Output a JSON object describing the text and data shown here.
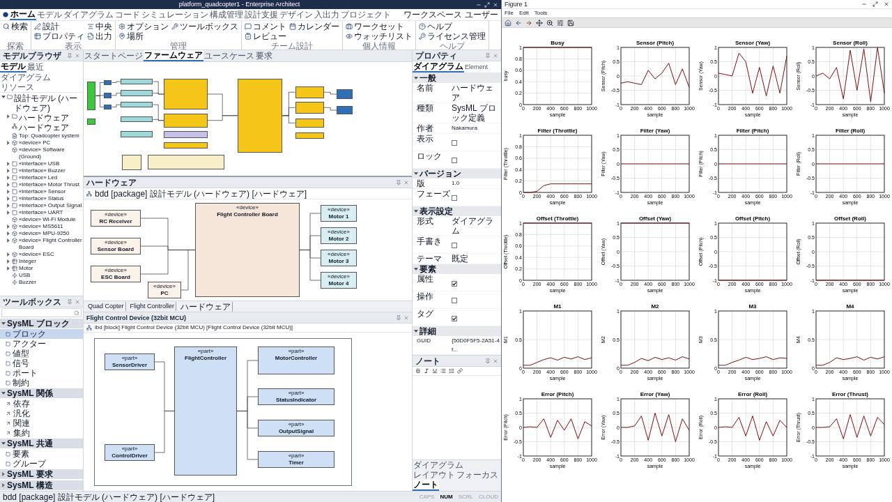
{
  "editor": {
    "title": "platform_quadcopter1 - Enterprise Architect",
    "ribbon_tabs": [
      {
        "label": "ホーム",
        "selected": true
      },
      {
        "label": "モデル",
        "selected": false
      },
      {
        "label": "ダイアグラム",
        "selected": false
      },
      {
        "label": "コード",
        "selected": false
      },
      {
        "label": "シミュレーション",
        "selected": false
      },
      {
        "label": "構成管理",
        "selected": false
      },
      {
        "label": "設計支援",
        "selected": false
      },
      {
        "label": "デザイン",
        "selected": false
      },
      {
        "label": "入出力",
        "selected": false
      },
      {
        "label": "プロジェクト",
        "selected": false
      }
    ],
    "workspace": "ワークスペース",
    "user": "ユーザー",
    "ribbon_groups": [
      {
        "label": "探索",
        "buttons": [
          "検索"
        ]
      },
      {
        "label": "表示",
        "buttons": [
          "設計",
          "プロパティ",
          "中央",
          "出力"
        ]
      },
      {
        "label": "管理",
        "buttons": [
          "オプション",
          "場所",
          "ツールボックス"
        ]
      },
      {
        "label": "チーム設計",
        "buttons": [
          "コメント",
          "レビュー",
          "カレンダー"
        ]
      },
      {
        "label": "個人情報",
        "buttons": [
          "ワークセット",
          "ウォッチリスト"
        ]
      },
      {
        "label": "ヘルプ",
        "buttons": [
          "ヘルプ",
          "ライセンス管理"
        ]
      }
    ],
    "model_browser": {
      "title": "モデルブラウザ",
      "tabs": [
        {
          "label": "モデル",
          "selected": true
        },
        {
          "label": "最近",
          "selected": false
        },
        {
          "label": "ダイアグラム",
          "selected": false
        },
        {
          "label": "リソース",
          "selected": false
        }
      ],
      "tree": [
        {
          "label": "設計モデル (ハードウェア)",
          "kind": "package",
          "expanded": true,
          "children": [
            {
              "label": "ハードウェア",
              "kind": "package",
              "expanded": false
            },
            {
              "label": "ハードウェア",
              "kind": "diagram"
            },
            {
              "label": "Top: Quadcopter system",
              "kind": "note"
            },
            {
              "label": "«device» PC",
              "kind": "device",
              "expanded": false
            },
            {
              "label": "«device» Software (Ground)",
              "kind": "device"
            },
            {
              "label": "«interface» USB",
              "kind": "interface",
              "expanded": false
            },
            {
              "label": "«interface» Buzzer",
              "kind": "interface",
              "expanded": false
            },
            {
              "label": "«interface» Led",
              "kind": "interface",
              "expanded": false
            },
            {
              "label": "«interface» Motor Thrust",
              "kind": "interface",
              "expanded": false
            },
            {
              "label": "«interface» Sensor",
              "kind": "interface",
              "expanded": false
            },
            {
              "label": "«interface» Status",
              "kind": "interface",
              "expanded": false
            },
            {
              "label": "«interface» Output Signal",
              "kind": "interface",
              "expanded": false
            },
            {
              "label": "«interface» UART",
              "kind": "interface",
              "expanded": false
            },
            {
              "label": "«device» Wi-Fi Module",
              "kind": "device"
            },
            {
              "label": "«device» MS5611",
              "kind": "device",
              "expanded": false
            },
            {
              "label": "«device» MPU-9250",
              "kind": "device",
              "expanded": false
            },
            {
              "label": "«device» Flight Controller Board",
              "kind": "device",
              "expanded": false
            },
            {
              "label": "«device» ESC",
              "kind": "device",
              "expanded": false
            },
            {
              "label": "Integer",
              "kind": "class",
              "expanded": false
            },
            {
              "label": "Motor",
              "kind": "class",
              "expanded": false
            },
            {
              "label": "USB",
              "kind": "signal"
            },
            {
              "label": "Buzzer",
              "kind": "signal"
            }
          ]
        }
      ]
    },
    "toolbox": {
      "title": "ツールボックス",
      "groups": [
        {
          "label": "SysML ブロック",
          "expanded": true,
          "items": [
            {
              "label": "ブロック",
              "selected": true
            },
            {
              "label": "アクター",
              "selected": false
            },
            {
              "label": "値型",
              "selected": false
            },
            {
              "label": "信号",
              "selected": false
            },
            {
              "label": "ポート",
              "selected": false
            },
            {
              "label": "制約",
              "selected": false
            }
          ]
        },
        {
          "label": "SysML 関係",
          "expanded": true,
          "items": [
            {
              "label": "依存",
              "selected": false
            },
            {
              "label": "汎化",
              "selected": false
            },
            {
              "label": "関連",
              "selected": false
            },
            {
              "label": "集約",
              "selected": false
            }
          ]
        },
        {
          "label": "SysML 共通",
          "expanded": true,
          "items": [
            {
              "label": "要素",
              "selected": false
            },
            {
              "label": "グループ",
              "selected": false
            }
          ]
        },
        {
          "label": "SysML 要求",
          "expanded": false
        },
        {
          "label": "SysML 構造",
          "expanded": false
        }
      ]
    },
    "diagram_tabs": [
      {
        "label": "スタートページ",
        "selected": false
      },
      {
        "label": "ファームウェア",
        "selected": true
      },
      {
        "label": "ユースケース",
        "selected": false
      },
      {
        "label": "要求",
        "selected": false
      }
    ],
    "firmware_diagram": {
      "nodes": [
        {
          "color": "#3cc83c"
        },
        {
          "color": "#3cc83c"
        },
        {
          "color": "#2e6fb5"
        },
        {
          "color": "#2e6fb5"
        },
        {
          "color": "#2e6fb5"
        },
        {
          "color": "#9ed8d8"
        },
        {
          "color": "#9ed8d8"
        },
        {
          "color": "#9ed8d8"
        },
        {
          "color": "#9ed8d8"
        },
        {
          "color": "#9ed8d8"
        },
        {
          "color": "#f5c518"
        },
        {
          "color": "#f5c518"
        },
        {
          "color": "#c9c0e8"
        },
        {
          "color": "#f5c518"
        },
        {
          "color": "#f5c518"
        },
        {
          "color": "#f5c518"
        },
        {
          "color": "#f5c518"
        },
        {
          "color": "#f5c518"
        },
        {
          "color": "#f5c518"
        },
        {
          "color": "#2e6fb5"
        },
        {
          "color": "#2e6fb5"
        },
        {
          "color": "#f6efc8"
        },
        {
          "color": "#f6efc8"
        }
      ]
    },
    "hardware_pane": {
      "title": "ハードウェア",
      "subtitle": "bdd [package] 設計モデル (ハードウェア) [ハードウェア]",
      "nodes": [
        {
          "stereotype": "«device»",
          "name": "RC Receiver",
          "color": "#fbf3ea"
        },
        {
          "stereotype": "«device»",
          "name": "Sensor Board",
          "color": "#fbf3ea"
        },
        {
          "stereotype": "«device»",
          "name": "ESC Board",
          "color": "#fbf3ea"
        },
        {
          "stereotype": "«device»",
          "name": "PC",
          "color": "#fbf3ea"
        },
        {
          "stereotype": "«device»",
          "name": "Flight Controller Board",
          "color": "#f6e6da"
        },
        {
          "stereotype": "«device»",
          "name": "Motor 1",
          "color": "#d8eef2"
        },
        {
          "stereotype": "«device»",
          "name": "Motor 2",
          "color": "#d8eef2"
        },
        {
          "stereotype": "«device»",
          "name": "Motor 3",
          "color": "#d8eef2"
        },
        {
          "stereotype": "«device»",
          "name": "Motor 4",
          "color": "#d8eef2"
        }
      ],
      "breadcrumb": [
        "Quad Copter",
        "Flight Controller",
        "ハードウェア"
      ]
    },
    "device_pane": {
      "title": "Flight Control Device (32bit MCU)",
      "subtitle": "ibd [block] Flight Control Device (32bit MCU) [Flight Control Device (32bit MCU)]",
      "nodes": [
        {
          "stereotype": "«part»",
          "name": "SensorDriver",
          "color": "#cfe0f5"
        },
        {
          "stereotype": "«part»",
          "name": "ControlDriver",
          "color": "#cfe0f5"
        },
        {
          "stereotype": "«part»",
          "name": "FlightController",
          "color": "#cfe0f5"
        },
        {
          "stereotype": "«part»",
          "name": "MotorController",
          "color": "#cfe0f5"
        },
        {
          "stereotype": "«part»",
          "name": "StatusIndicator",
          "color": "#cfe0f5"
        },
        {
          "stereotype": "«part»",
          "name": "OutputSignal",
          "color": "#cfe0f5"
        },
        {
          "stereotype": "«part»",
          "name": "Timer",
          "color": "#cfe0f5"
        }
      ]
    },
    "properties": {
      "title": "プロパティ",
      "tabs": [
        {
          "label": "ダイアグラム",
          "selected": true
        },
        {
          "label": "Element",
          "selected": false
        }
      ],
      "sections": [
        {
          "label": "一般",
          "expanded": true,
          "rows": [
            {
              "name": "名前",
              "kind": "text",
              "value": "ハードウェア"
            },
            {
              "name": "種類",
              "kind": "text",
              "value": "SysML ブロック定義"
            },
            {
              "name": "作者",
              "kind": "text",
              "value": "Nakamura"
            },
            {
              "name": "表示",
              "kind": "check",
              "checked": false
            },
            {
              "name": "ロック",
              "kind": "check",
              "checked": false
            }
          ]
        },
        {
          "label": "バージョン",
          "expanded": true,
          "rows": [
            {
              "name": "版",
              "kind": "text",
              "value": "1.0"
            },
            {
              "name": "フェーズ",
              "kind": "check",
              "checked": false
            }
          ]
        },
        {
          "label": "表示設定",
          "expanded": true,
          "rows": [
            {
              "name": "形式",
              "kind": "text",
              "value": "ダイアグラム"
            },
            {
              "name": "手書き",
              "kind": "check",
              "checked": false
            },
            {
              "name": "テーマ",
              "kind": "text",
              "value": "既定"
            }
          ]
        },
        {
          "label": "要素",
          "expanded": true,
          "rows": [
            {
              "name": "属性",
              "kind": "check",
              "checked": true
            },
            {
              "name": "操作",
              "kind": "check",
              "checked": false
            },
            {
              "name": "タグ",
              "kind": "check",
              "checked": true
            }
          ]
        },
        {
          "label": "詳細",
          "expanded": true,
          "rows": [
            {
              "name": "GUID",
              "kind": "text",
              "value": "{50D0F5F5-2A51-4f..."
            }
          ]
        }
      ]
    },
    "notes": {
      "title": "ノート",
      "tabs": [
        {
          "label": "ダイアグラム",
          "selected": false
        },
        {
          "label": "レイアウト",
          "selected": false
        },
        {
          "label": "フォーカス",
          "selected": false
        },
        {
          "label": "ノート",
          "selected": true
        }
      ]
    },
    "status": {
      "path": "bdd [package] 設計モデル (ハードウェア) [ハードウェア]",
      "indicators": [
        {
          "label": "CAPS",
          "on": false
        },
        {
          "label": "NUM",
          "on": true
        },
        {
          "label": "SCRL",
          "on": false
        },
        {
          "label": "CLOUD",
          "on": false
        }
      ]
    }
  },
  "figure": {
    "title": "Figure 1",
    "menu": [
      "File",
      "Edit",
      "Tools"
    ],
    "charts": [
      {
        "chart_data": {
          "type": "line",
          "title": "Busy",
          "xlabel": "sample",
          "ylabel": "busy",
          "x": [
            0,
            100,
            200,
            300,
            400,
            500,
            600,
            700,
            800,
            900,
            1000
          ],
          "series": [
            {
              "color": "#7a1010",
              "values": [
                1,
                1,
                1,
                1,
                1,
                1,
                1,
                1,
                1,
                1,
                1
              ]
            }
          ],
          "xlim": [
            0,
            1000
          ],
          "ylim": [
            0,
            1
          ],
          "xticks": [
            0,
            200,
            400,
            600,
            800,
            1000
          ],
          "yticks": [
            0,
            0.2,
            0.4,
            0.6,
            0.8,
            1
          ],
          "grid": true
        }
      },
      {
        "chart_data": {
          "type": "line",
          "title": "Sensor (Pitch)",
          "xlabel": "sample",
          "ylabel": "Sensor (Pitch)",
          "x": [
            0,
            100,
            200,
            300,
            400,
            500,
            600,
            700,
            800,
            900,
            1000
          ],
          "series": [
            {
              "color": "#7a1010",
              "values": [
                -0.25,
                -0.2,
                -0.25,
                -0.3,
                0.2,
                -0.1,
                0.1,
                0.45,
                -0.3,
                0.25,
                -0.4
              ]
            }
          ],
          "xlim": [
            0,
            1000
          ],
          "ylim": [
            -1,
            1
          ],
          "xticks": [
            0,
            200,
            400,
            600,
            800,
            1000
          ],
          "yticks": [
            -1,
            -0.5,
            0,
            0.5,
            1
          ],
          "grid": true
        }
      },
      {
        "chart_data": {
          "type": "line",
          "title": "Sensor (Yaw)",
          "xlabel": "sample",
          "ylabel": "Sensor (Yaw)",
          "x": [
            0,
            100,
            200,
            300,
            400,
            500,
            600,
            700,
            800,
            900,
            1000
          ],
          "series": [
            {
              "color": "#7a1010",
              "values": [
                0.1,
                0.05,
                0,
                0.8,
                0.5,
                -0.6,
                0.3,
                -0.7,
                0.35,
                -0.6,
                0.7
              ]
            }
          ],
          "xlim": [
            0,
            1000
          ],
          "ylim": [
            -1,
            1
          ],
          "xticks": [
            0,
            200,
            400,
            600,
            800,
            1000
          ],
          "yticks": [
            -1,
            -0.5,
            0,
            0.5,
            1
          ],
          "grid": true
        }
      },
      {
        "chart_data": {
          "type": "line",
          "title": "Sensor (Roll)",
          "xlabel": "sample",
          "ylabel": "Sensor (Roll)",
          "x": [
            0,
            100,
            200,
            300,
            400,
            500,
            600,
            700,
            800,
            900,
            1000
          ],
          "series": [
            {
              "color": "#7a1010",
              "values": [
                0,
                0.1,
                -0.1,
                0.3,
                -0.8,
                0.9,
                -0.5,
                0.95,
                -0.9,
                1,
                -0.6
              ]
            }
          ],
          "xlim": [
            0,
            1000
          ],
          "ylim": [
            -1,
            1
          ],
          "xticks": [
            0,
            200,
            400,
            600,
            800,
            1000
          ],
          "yticks": [
            -1,
            -0.5,
            0,
            0.5,
            1
          ],
          "grid": true
        }
      },
      {
        "chart_data": {
          "type": "line",
          "title": "Filter (Throttle)",
          "xlabel": "sample",
          "ylabel": "Filter (Throttle)",
          "x": [
            0,
            100,
            200,
            300,
            400,
            500,
            600,
            700,
            800,
            900,
            1000
          ],
          "series": [
            {
              "color": "#7a1010",
              "values": [
                0,
                0,
                0.02,
                0.12,
                0.15,
                0.15,
                0.15,
                0.15,
                0.15,
                0.15,
                0.15
              ]
            }
          ],
          "xlim": [
            0,
            1000
          ],
          "ylim": [
            0,
            1
          ],
          "xticks": [
            0,
            200,
            400,
            600,
            800,
            1000
          ],
          "yticks": [
            0,
            0.2,
            0.4,
            0.6,
            0.8,
            1
          ],
          "grid": true
        }
      },
      {
        "chart_data": {
          "type": "line",
          "title": "Filter (Yaw)",
          "xlabel": "sample",
          "ylabel": "Filter (Yaw)",
          "x": [
            0,
            100,
            200,
            300,
            400,
            500,
            600,
            700,
            800,
            900,
            1000
          ],
          "series": [
            {
              "color": "#7a1010",
              "values": [
                0,
                0,
                0,
                0,
                0,
                0,
                0,
                0,
                0,
                0,
                0
              ]
            }
          ],
          "xlim": [
            0,
            1000
          ],
          "ylim": [
            -1,
            1
          ],
          "xticks": [
            0,
            200,
            400,
            600,
            800,
            1000
          ],
          "yticks": [
            -1,
            -0.5,
            0,
            0.5,
            1
          ],
          "grid": true
        }
      },
      {
        "chart_data": {
          "type": "line",
          "title": "Filter (Pitch)",
          "xlabel": "sample",
          "ylabel": "Filter (Pitch)",
          "x": [
            0,
            100,
            200,
            300,
            400,
            500,
            600,
            700,
            800,
            900,
            1000
          ],
          "series": [
            {
              "color": "#7a1010",
              "values": [
                0,
                0,
                0,
                0,
                0,
                0,
                0,
                0,
                0,
                0,
                0
              ]
            }
          ],
          "xlim": [
            0,
            1000
          ],
          "ylim": [
            -1,
            1
          ],
          "xticks": [
            0,
            200,
            400,
            600,
            800,
            1000
          ],
          "yticks": [
            -1,
            -0.5,
            0,
            0.5,
            1
          ],
          "grid": true
        }
      },
      {
        "chart_data": {
          "type": "line",
          "title": "Filter (Roll)",
          "xlabel": "sample",
          "ylabel": "Filter (Roll)",
          "x": [
            0,
            100,
            200,
            300,
            400,
            500,
            600,
            700,
            800,
            900,
            1000
          ],
          "series": [
            {
              "color": "#7a1010",
              "values": [
                0,
                0,
                0,
                0,
                0,
                0,
                0,
                0,
                0,
                0,
                0
              ]
            }
          ],
          "xlim": [
            0,
            1000
          ],
          "ylim": [
            -1,
            1
          ],
          "xticks": [
            0,
            200,
            400,
            600,
            800,
            1000
          ],
          "yticks": [
            -1,
            -0.5,
            0,
            0.5,
            1
          ],
          "grid": true
        }
      },
      {
        "chart_data": {
          "type": "line",
          "title": "Offset (Throttle)",
          "xlabel": "sample",
          "ylabel": "Offset (Throttle)",
          "x": [
            0,
            100,
            200,
            300,
            400,
            500,
            600,
            700,
            800,
            900,
            1000
          ],
          "series": [
            {
              "color": "#7a1010",
              "values": [
                1,
                1,
                1,
                1,
                1,
                1,
                1,
                1,
                1,
                1,
                1
              ]
            }
          ],
          "xlim": [
            0,
            1000
          ],
          "ylim": [
            0,
            1
          ],
          "xticks": [
            0,
            200,
            400,
            600,
            800,
            1000
          ],
          "yticks": [
            0,
            0.2,
            0.4,
            0.6,
            0.8,
            1
          ],
          "grid": true
        }
      },
      {
        "chart_data": {
          "type": "line",
          "title": "Offset (Yaw)",
          "xlabel": "sample",
          "ylabel": "Offset (Yaw)",
          "x": [
            0,
            100,
            200,
            300,
            400,
            500,
            600,
            700,
            800,
            900,
            1000
          ],
          "series": [
            {
              "color": "#7a1010",
              "values": [
                1,
                1,
                1,
                1,
                1,
                1,
                1,
                1,
                1,
                1,
                1
              ]
            }
          ],
          "xlim": [
            0,
            1000
          ],
          "ylim": [
            -1,
            1
          ],
          "xticks": [
            0,
            200,
            400,
            600,
            800,
            1000
          ],
          "yticks": [
            -1,
            -0.5,
            0,
            0.5,
            1
          ],
          "grid": true
        }
      },
      {
        "chart_data": {
          "type": "line",
          "title": "Offset (Pitch)",
          "xlabel": "sample",
          "ylabel": "Offset (Pitch)",
          "x": [
            0,
            100,
            200,
            300,
            400,
            500,
            600,
            700,
            800,
            900,
            1000
          ],
          "series": [
            {
              "color": "#7a1010",
              "values": [
                -1,
                -1,
                -1,
                -1,
                -1,
                -1,
                -1,
                -1,
                -1,
                -1,
                -1
              ]
            }
          ],
          "xlim": [
            0,
            1000
          ],
          "ylim": [
            -1,
            1
          ],
          "xticks": [
            0,
            200,
            400,
            600,
            800,
            1000
          ],
          "yticks": [
            -1,
            -0.5,
            0,
            0.5,
            1
          ],
          "grid": true
        }
      },
      {
        "chart_data": {
          "type": "line",
          "title": "Offset (Roll)",
          "xlabel": "sample",
          "ylabel": "Offset (Roll)",
          "x": [
            0,
            100,
            200,
            300,
            400,
            500,
            600,
            700,
            800,
            900,
            1000
          ],
          "series": [
            {
              "color": "#7a1010",
              "values": [
                -1,
                -1,
                -1,
                -1,
                -1,
                -1,
                -1,
                -1,
                -1,
                -1,
                -1
              ]
            }
          ],
          "xlim": [
            0,
            1000
          ],
          "ylim": [
            -1,
            1
          ],
          "xticks": [
            0,
            200,
            400,
            600,
            800,
            1000
          ],
          "yticks": [
            -1,
            -0.5,
            0,
            0.5,
            1
          ],
          "grid": true
        }
      },
      {
        "chart_data": {
          "type": "line",
          "title": "M1",
          "xlabel": "sample",
          "ylabel": "M1",
          "x": [
            0,
            100,
            200,
            300,
            400,
            500,
            600,
            700,
            800,
            900,
            1000
          ],
          "series": [
            {
              "color": "#7a1010",
              "values": [
                0.05,
                0.05,
                0.1,
                0.15,
                0.18,
                0.14,
                0.19,
                0.16,
                0.2,
                0.15,
                0.18
              ]
            }
          ],
          "xlim": [
            0,
            1000
          ],
          "ylim": [
            0,
            1
          ],
          "xticks": [
            0,
            200,
            400,
            600,
            800,
            1000
          ],
          "yticks": [
            0,
            0.5,
            1
          ],
          "grid": true
        }
      },
      {
        "chart_data": {
          "type": "line",
          "title": "M2",
          "xlabel": "sample",
          "ylabel": "M2",
          "x": [
            0,
            100,
            200,
            300,
            400,
            500,
            600,
            700,
            800,
            900,
            1000
          ],
          "series": [
            {
              "color": "#7a1010",
              "values": [
                0.05,
                0.05,
                0.1,
                0.17,
                0.13,
                0.19,
                0.15,
                0.18,
                0.14,
                0.2,
                0.16
              ]
            }
          ],
          "xlim": [
            0,
            1000
          ],
          "ylim": [
            0,
            1
          ],
          "xticks": [
            0,
            200,
            400,
            600,
            800,
            1000
          ],
          "yticks": [
            0,
            0.5,
            1
          ],
          "grid": true
        }
      },
      {
        "chart_data": {
          "type": "line",
          "title": "M3",
          "xlabel": "sample",
          "ylabel": "M3",
          "x": [
            0,
            100,
            200,
            300,
            400,
            500,
            600,
            700,
            800,
            900,
            1000
          ],
          "series": [
            {
              "color": "#7a1010",
              "values": [
                0.05,
                0.05,
                0.1,
                0.14,
                0.19,
                0.15,
                0.17,
                0.2,
                0.15,
                0.18,
                0.17
              ]
            }
          ],
          "xlim": [
            0,
            1000
          ],
          "ylim": [
            0,
            1
          ],
          "xticks": [
            0,
            200,
            400,
            600,
            800,
            1000
          ],
          "yticks": [
            0,
            0.5,
            1
          ],
          "grid": true
        }
      },
      {
        "chart_data": {
          "type": "line",
          "title": "M4",
          "xlabel": "sample",
          "ylabel": "M4",
          "x": [
            0,
            100,
            200,
            300,
            400,
            500,
            600,
            700,
            800,
            900,
            1000
          ],
          "series": [
            {
              "color": "#7a1010",
              "values": [
                0.05,
                0.05,
                0.1,
                0.18,
                0.15,
                0.17,
                0.2,
                0.14,
                0.19,
                0.16,
                0.2
              ]
            }
          ],
          "xlim": [
            0,
            1000
          ],
          "ylim": [
            0,
            1
          ],
          "xticks": [
            0,
            200,
            400,
            600,
            800,
            1000
          ],
          "yticks": [
            0,
            0.5,
            1
          ],
          "grid": true
        }
      },
      {
        "chart_data": {
          "type": "line",
          "title": "Error (Pitch)",
          "xlabel": "sample",
          "ylabel": "Error (Pitch)",
          "x": [
            0,
            100,
            200,
            300,
            400,
            500,
            600,
            700,
            800,
            900,
            1000
          ],
          "series": [
            {
              "color": "#7a1010",
              "values": [
                0,
                0.02,
                0,
                0.3,
                -0.35,
                0.25,
                -0.1,
                0.3,
                -0.4,
                0.2,
                0.05
              ]
            }
          ],
          "xlim": [
            0,
            1000
          ],
          "ylim": [
            -1,
            1
          ],
          "xticks": [
            0,
            200,
            400,
            600,
            800,
            1000
          ],
          "yticks": [
            -1,
            -0.5,
            0,
            0.5,
            1
          ],
          "grid": true
        }
      },
      {
        "chart_data": {
          "type": "line",
          "title": "Error (Yaw)",
          "xlabel": "sample",
          "ylabel": "Error (Yaw)",
          "x": [
            0,
            100,
            200,
            300,
            400,
            500,
            600,
            700,
            800,
            900,
            1000
          ],
          "series": [
            {
              "color": "#7a1010",
              "values": [
                0,
                0,
                0.05,
                0.4,
                -0.45,
                0.5,
                -0.3,
                0.45,
                -0.5,
                0.3,
                -0.1
              ]
            }
          ],
          "xlim": [
            0,
            1000
          ],
          "ylim": [
            -1,
            1
          ],
          "xticks": [
            0,
            200,
            400,
            600,
            800,
            1000
          ],
          "yticks": [
            -1,
            -0.5,
            0,
            0.5,
            1
          ],
          "grid": true
        }
      },
      {
        "chart_data": {
          "type": "line",
          "title": "Error (Roll)",
          "xlabel": "sample",
          "ylabel": "Error (Roll)",
          "x": [
            0,
            100,
            200,
            300,
            400,
            500,
            600,
            700,
            800,
            900,
            1000
          ],
          "series": [
            {
              "color": "#7a1010",
              "values": [
                0,
                0.02,
                0,
                0.35,
                -0.3,
                0.4,
                -0.45,
                0.2,
                -0.3,
                0.25,
                0
              ]
            }
          ],
          "xlim": [
            0,
            1000
          ],
          "ylim": [
            -1,
            1
          ],
          "xticks": [
            0,
            200,
            400,
            600,
            800,
            1000
          ],
          "yticks": [
            -1,
            -0.5,
            0,
            0.5,
            1
          ],
          "grid": true
        }
      },
      {
        "chart_data": {
          "type": "line",
          "title": "Error (Thrust)",
          "xlabel": "sample",
          "ylabel": "Error (Thrust)",
          "x": [
            0,
            100,
            200,
            300,
            400,
            500,
            600,
            700,
            800,
            900,
            1000
          ],
          "series": [
            {
              "color": "#7a1010",
              "values": [
                0,
                0,
                0.02,
                0.3,
                -0.4,
                0.45,
                -0.35,
                0.4,
                -0.3,
                0.35,
                0.1
              ]
            }
          ],
          "xlim": [
            0,
            1000
          ],
          "ylim": [
            -1,
            1
          ],
          "xticks": [
            0,
            200,
            400,
            600,
            800,
            1000
          ],
          "yticks": [
            -1,
            -0.5,
            0,
            0.5,
            1
          ],
          "grid": true
        }
      }
    ]
  }
}
